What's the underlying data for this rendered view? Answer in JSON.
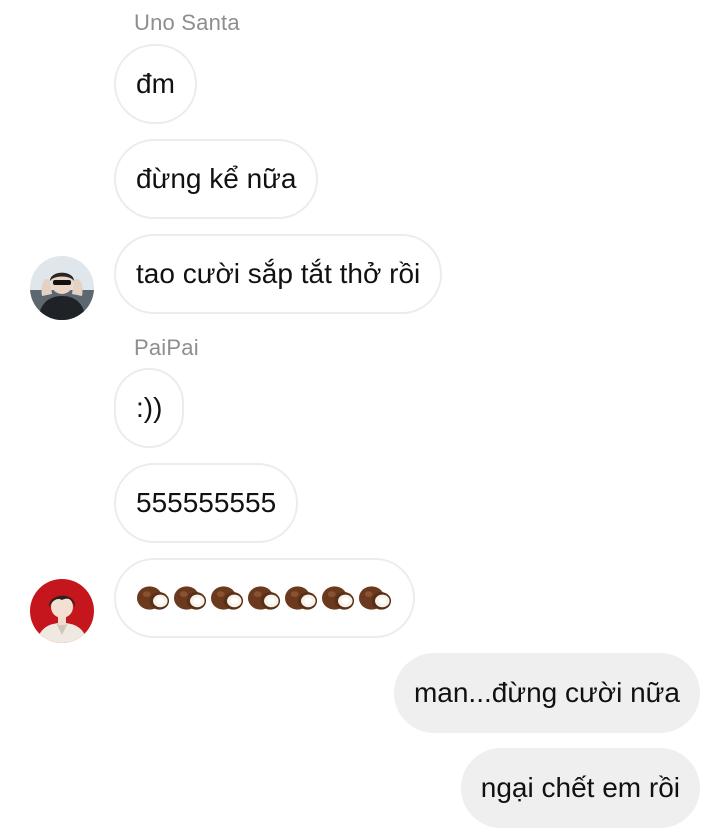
{
  "messages": {
    "group1_sender": "Uno Santa",
    "group1": [
      "đm",
      "đừng kể nữa",
      "tao cười sắp tắt thở rồi"
    ],
    "group2_sender": "PaiPai",
    "group2": [
      ":))",
      "555555555"
    ],
    "group2_emoji": {
      "icon": "coconut-emoji",
      "count": 7
    },
    "outgoing": [
      "man...đừng cười nữa",
      "ngại chết em rồi"
    ]
  },
  "colors": {
    "incoming_bubble_border": "#ececec",
    "outgoing_bubble_fill": "#efefef",
    "sender_name": "#8e8e8e",
    "avatar2_background": "#c4161c"
  }
}
